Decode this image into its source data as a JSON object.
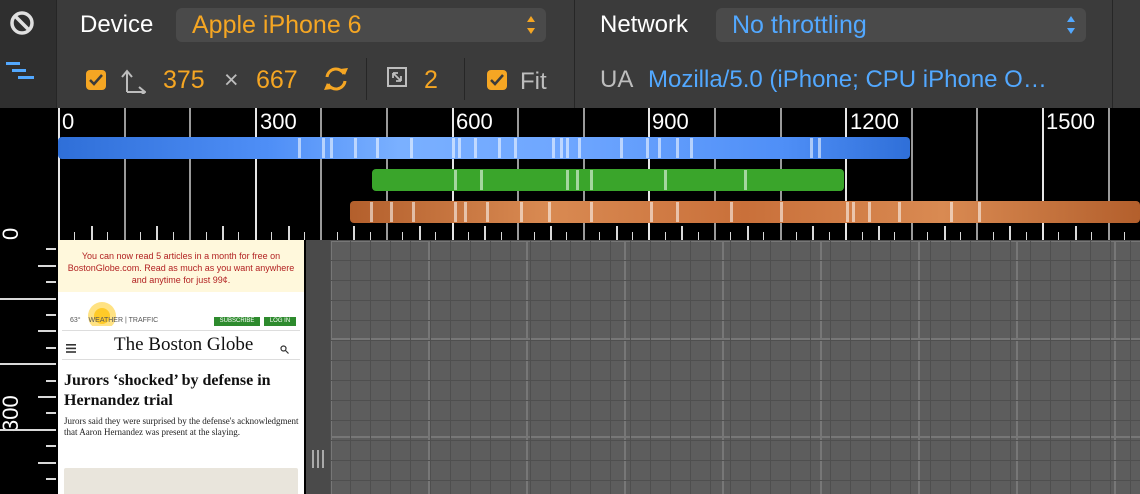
{
  "toolbar": {
    "device_label": "Device",
    "device_value": "Apple iPhone 6",
    "width": "375",
    "times": "×",
    "height": "667",
    "dpr": "2",
    "fit_label": "Fit",
    "network_label": "Network",
    "network_value": "No throttling",
    "ua_label": "UA",
    "ua_value": "Mozilla/5.0 (iPhone; CPU iPhone O…"
  },
  "timeline": {
    "tick_labels": [
      "0",
      "300",
      "600",
      "900",
      "1200",
      "1500"
    ],
    "vertical_labels": [
      "0",
      "300"
    ]
  },
  "page": {
    "banner_text": "You can now read 5 articles in a month for free on BostonGlobe.com. Read as much as you want anywhere and anytime for just 99¢.",
    "temp": "63°",
    "weather": "WEATHER",
    "sep": "|",
    "traffic": "TRAFFIC",
    "subscribe": "SUBSCRIBE",
    "login": "LOG IN",
    "masthead": "The Boston Globe",
    "headline": "Jurors ‘shocked’ by defense in Hernandez trial",
    "summary": "Jurors said they were surprised by the defense's acknowledgment that Aaron Hernandez was present at the slaying."
  },
  "colors": {
    "accent_orange": "#f5a623",
    "accent_blue": "#52a8ff",
    "bar_blue": "#4f8ff7",
    "bar_green": "#3aa52b",
    "bar_orange": "#c9703a"
  },
  "icons": [
    "no-entry-icon",
    "waterfall-icon",
    "checkbox-checked-icon",
    "resize-icon",
    "rotate-icon",
    "dpr-icon",
    "select-arrows-icon",
    "hamburger-icon",
    "search-icon",
    "resize-handle-icon"
  ]
}
